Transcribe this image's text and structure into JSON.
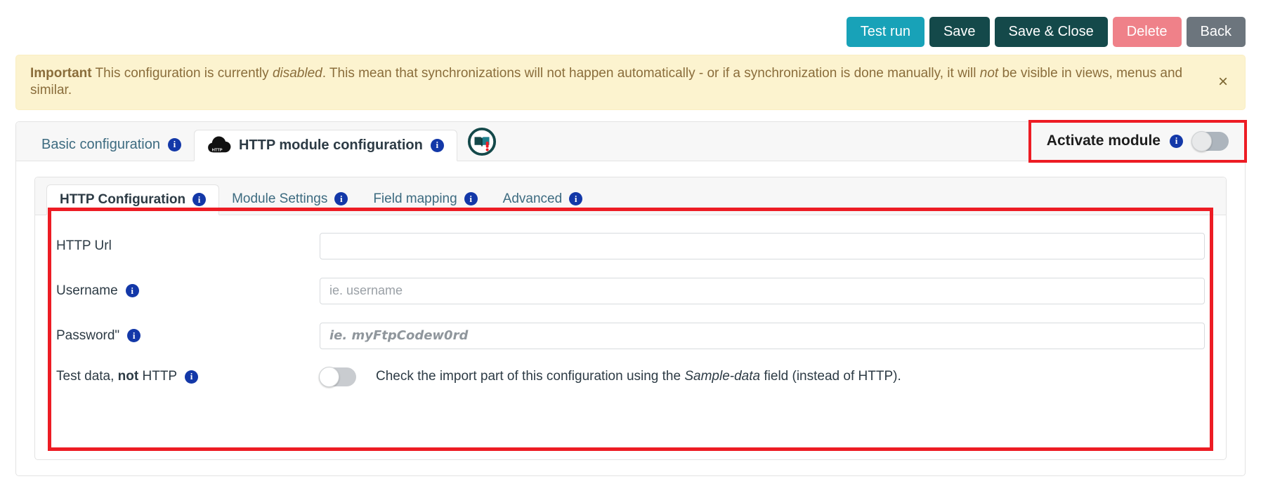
{
  "toolbar": {
    "buttons": [
      {
        "label": "Test run",
        "name": "test-run-button"
      },
      {
        "label": "Save",
        "name": "save-button"
      },
      {
        "label": "Save & Close",
        "name": "save-and-close-button"
      },
      {
        "label": "Delete",
        "name": "delete-button"
      },
      {
        "label": "Back",
        "name": "back-button"
      }
    ],
    "colors": {
      "test_run": "#18a2b8",
      "save": "#14494a",
      "save_close": "#14494a",
      "delete": "#ef8189",
      "back": "#6c757d"
    }
  },
  "alert": {
    "strong": "Important",
    "text_1": " This configuration is currently ",
    "emphasis_1": "disabled",
    "text_2": ". This mean that synchronizations will not happen automatically - or if a synchronization is done manually, it will ",
    "emphasis_2": "not",
    "text_3": " be visible in views, menus and similar.",
    "close_label": "×",
    "background": "#fcf3cf",
    "text_color": "#8a6d3b"
  },
  "outer_tabs": [
    {
      "label": "Basic configuration",
      "active": false,
      "icon": "",
      "name": "tab-basic-configuration"
    },
    {
      "label": "HTTP module configuration",
      "active": true,
      "icon": "http-cloud-icon",
      "name": "tab-http-module-configuration"
    }
  ],
  "documentation_badge": {
    "icon": "book-icon",
    "alert_marker": "!",
    "color": "#14494a",
    "marker_color": "#ed1c24"
  },
  "activate_module": {
    "label": "Activate module",
    "toggle_state": "off",
    "highlight_color": "#ed1c24"
  },
  "inner_tabs": [
    {
      "label": "HTTP Configuration",
      "active": true,
      "name": "tab-http-configuration"
    },
    {
      "label": "Module Settings",
      "active": false,
      "name": "tab-module-settings"
    },
    {
      "label": "Field mapping",
      "active": false,
      "name": "tab-field-mapping"
    },
    {
      "label": "Advanced",
      "active": false,
      "name": "tab-advanced"
    }
  ],
  "form": {
    "http_url": {
      "label": "HTTP Url",
      "value": "",
      "placeholder": "",
      "has_info": false
    },
    "username": {
      "label": "Username",
      "value": "",
      "placeholder": "ie. username",
      "has_info": true
    },
    "password": {
      "label": "Password\"",
      "value": "",
      "placeholder": "ie. myFtpCodew0rd",
      "has_info": true
    },
    "test_data": {
      "label_prefix": "Test data, ",
      "label_bold": "not",
      "label_suffix": " HTTP",
      "toggle_state": "off",
      "helper_prefix": "Check the import part of this configuration using the ",
      "helper_emphasis": "Sample-data",
      "helper_suffix": " field (instead of HTTP)."
    },
    "highlight_color": "#ed1c24"
  },
  "icons": {
    "info": "i"
  }
}
